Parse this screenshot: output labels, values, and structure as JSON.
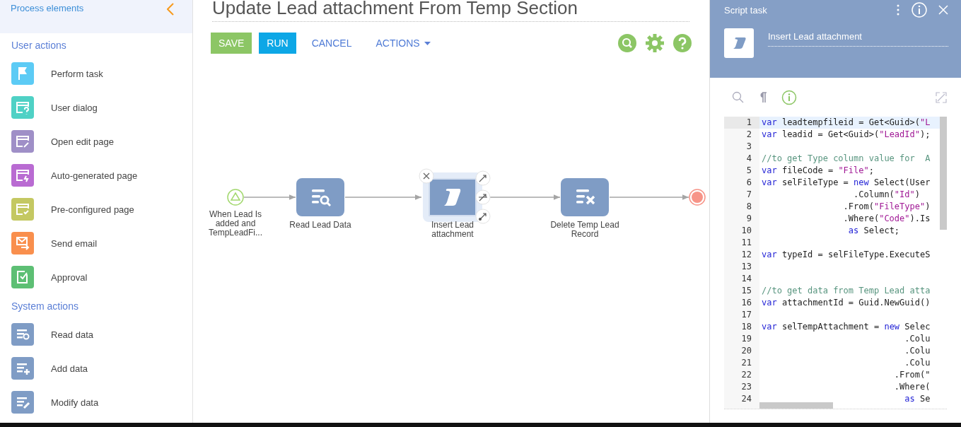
{
  "sidebar": {
    "title": "Process elements",
    "sections": [
      {
        "title": "User actions",
        "items": [
          {
            "label": "Perform task",
            "kind": "flag",
            "color": "#5ccbf5"
          },
          {
            "label": "User dialog",
            "kind": "dialog",
            "color": "#4fd1c5"
          },
          {
            "label": "Open edit page",
            "kind": "edit",
            "color": "#9f8fc7"
          },
          {
            "label": "Auto-generated page",
            "kind": "auto",
            "color": "#b96bd2"
          },
          {
            "label": "Pre-configured page",
            "kind": "preconf",
            "color": "#c4c862"
          },
          {
            "label": "Send email",
            "kind": "email",
            "color": "#f98f4d"
          },
          {
            "label": "Approval",
            "kind": "approval",
            "color": "#5dbf74"
          }
        ]
      },
      {
        "title": "System actions",
        "items": [
          {
            "label": "Read data",
            "kind": "read",
            "color": "#7f9cc5"
          },
          {
            "label": "Add data",
            "kind": "add",
            "color": "#7f9cc5"
          },
          {
            "label": "Modify data",
            "kind": "modify",
            "color": "#7f9cc5"
          }
        ]
      }
    ]
  },
  "process": {
    "title": "Update Lead attachment From Temp Section",
    "toolbar": [
      {
        "label": "SAVE",
        "kind": "save"
      },
      {
        "label": "RUN",
        "kind": "run"
      },
      {
        "label": "CANCEL",
        "kind": "link"
      },
      {
        "label": "ACTIONS",
        "kind": "menu"
      }
    ],
    "nodes": [
      {
        "kind": "start",
        "label": "When Lead Is added and TempLeadFi...",
        "selected": false
      },
      {
        "kind": "read",
        "label": "Read Lead Data",
        "selected": false
      },
      {
        "kind": "script",
        "label": "Insert Lead attachment",
        "selected": true
      },
      {
        "kind": "delete",
        "label": "Delete Temp Lead Record",
        "selected": false
      },
      {
        "kind": "end",
        "selected": false
      }
    ]
  },
  "panel": {
    "title": "Script task",
    "element_name": "Insert Lead attachment",
    "code": [
      {
        "number": "1",
        "tokens": [
          {
            "kind": "keyword",
            "text": "var"
          },
          {
            "kind": "plain",
            "text": " leadtempfileid = Get<Guid>("
          },
          {
            "kind": "string",
            "text": "\"L"
          }
        ]
      },
      {
        "number": "2",
        "tokens": [
          {
            "kind": "keyword",
            "text": "var"
          },
          {
            "kind": "plain",
            "text": " leadid = Get<Guid>("
          },
          {
            "kind": "string",
            "text": "\"LeadId\""
          },
          {
            "kind": "plain",
            "text": ");"
          }
        ]
      },
      {
        "number": "3"
      },
      {
        "number": "4",
        "tokens": [
          {
            "kind": "comment",
            "text": "//to get Type column value for  A"
          }
        ]
      },
      {
        "number": "5",
        "tokens": [
          {
            "kind": "keyword",
            "text": "var"
          },
          {
            "kind": "plain",
            "text": " fileCode = "
          },
          {
            "kind": "string",
            "text": "\"File\""
          },
          {
            "kind": "plain",
            "text": ";"
          }
        ]
      },
      {
        "number": "6",
        "tokens": [
          {
            "kind": "keyword",
            "text": "var"
          },
          {
            "kind": "plain",
            "text": " selFileType = "
          },
          {
            "kind": "keyword",
            "text": "new"
          },
          {
            "kind": "plain",
            "text": " Select(User"
          }
        ]
      },
      {
        "number": "7",
        "tokens": [
          {
            "kind": "plain",
            "text": "                  .Column("
          },
          {
            "kind": "string",
            "text": "\"Id\""
          },
          {
            "kind": "plain",
            "text": ")"
          }
        ]
      },
      {
        "number": "8",
        "tokens": [
          {
            "kind": "plain",
            "text": "                .From("
          },
          {
            "kind": "string",
            "text": "\"FileType\""
          },
          {
            "kind": "plain",
            "text": ")"
          }
        ]
      },
      {
        "number": "9",
        "tokens": [
          {
            "kind": "plain",
            "text": "                .Where("
          },
          {
            "kind": "string",
            "text": "\"Code\""
          },
          {
            "kind": "plain",
            "text": ").Is"
          }
        ]
      },
      {
        "number": "10",
        "tokens": [
          {
            "kind": "keyword",
            "text": "                 as"
          },
          {
            "kind": "plain",
            "text": " Select;"
          }
        ]
      },
      {
        "number": "11"
      },
      {
        "number": "12",
        "tokens": [
          {
            "kind": "keyword",
            "text": "var"
          },
          {
            "kind": "plain",
            "text": " typeId = selFileType.ExecuteS"
          }
        ]
      },
      {
        "number": "13"
      },
      {
        "number": "14"
      },
      {
        "number": "15",
        "tokens": [
          {
            "kind": "comment",
            "text": "//to get data from Temp Lead atta"
          }
        ]
      },
      {
        "number": "16",
        "tokens": [
          {
            "kind": "keyword",
            "text": "var"
          },
          {
            "kind": "plain",
            "text": " attachmentId = Guid.NewGuid()"
          }
        ]
      },
      {
        "number": "17"
      },
      {
        "number": "18",
        "tokens": [
          {
            "kind": "keyword",
            "text": "var"
          },
          {
            "kind": "plain",
            "text": " selTempAttachment = "
          },
          {
            "kind": "keyword",
            "text": "new"
          },
          {
            "kind": "plain",
            "text": " Selec"
          }
        ]
      },
      {
        "number": "19",
        "tokens": [
          {
            "kind": "plain",
            "text": "                            .Colu"
          }
        ]
      },
      {
        "number": "20",
        "tokens": [
          {
            "kind": "plain",
            "text": "                            .Colu"
          }
        ]
      },
      {
        "number": "21",
        "tokens": [
          {
            "kind": "plain",
            "text": "                            .Colu"
          }
        ]
      },
      {
        "number": "22",
        "tokens": [
          {
            "kind": "plain",
            "text": "                          .From(\""
          }
        ]
      },
      {
        "number": "23",
        "tokens": [
          {
            "kind": "plain",
            "text": "                          .Where("
          }
        ]
      },
      {
        "number": "24",
        "tokens": [
          {
            "kind": "keyword",
            "text": "                            as"
          },
          {
            "kind": "plain",
            "text": " Se"
          }
        ]
      }
    ]
  }
}
